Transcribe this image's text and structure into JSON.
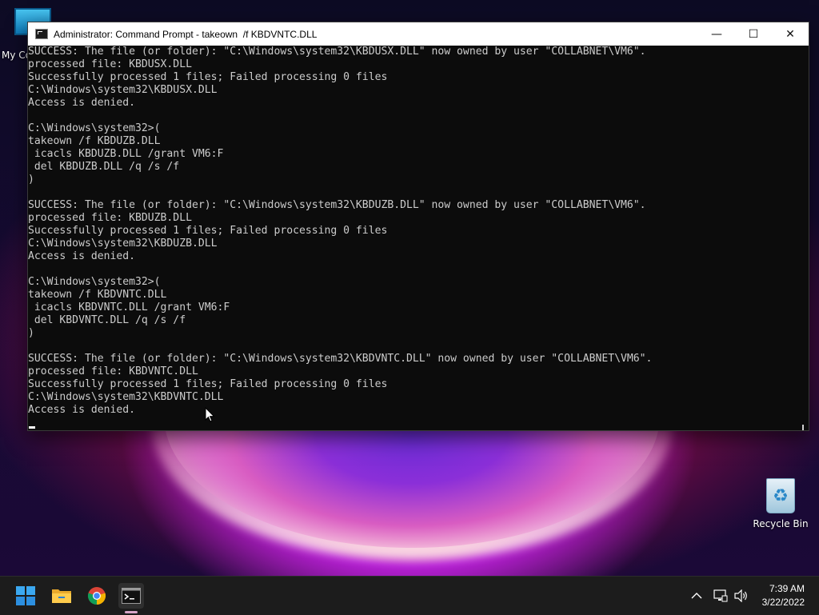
{
  "desktop": {
    "icons": [
      {
        "label": "My Co",
        "name": "my-computer"
      },
      {
        "label": "Recycle Bin",
        "name": "recycle-bin"
      }
    ]
  },
  "window": {
    "title": "Administrator: Command Prompt - takeown  /f KBDVNTC.DLL",
    "buttons": {
      "minimize": "—",
      "maximize": "☐",
      "close": "✕"
    }
  },
  "console": {
    "lines": [
      "SUCCESS: The file (or folder): \"C:\\Windows\\system32\\KBDUSX.DLL\" now owned by user \"COLLABNET\\VM6\".",
      "processed file: KBDUSX.DLL",
      "Successfully processed 1 files; Failed processing 0 files",
      "C:\\Windows\\system32\\KBDUSX.DLL",
      "Access is denied.",
      "",
      "C:\\Windows\\system32>(",
      "takeown /f KBDUZB.DLL",
      " icacls KBDUZB.DLL /grant VM6:F",
      " del KBDUZB.DLL /q /s /f",
      ")",
      "",
      "SUCCESS: The file (or folder): \"C:\\Windows\\system32\\KBDUZB.DLL\" now owned by user \"COLLABNET\\VM6\".",
      "processed file: KBDUZB.DLL",
      "Successfully processed 1 files; Failed processing 0 files",
      "C:\\Windows\\system32\\KBDUZB.DLL",
      "Access is denied.",
      "",
      "C:\\Windows\\system32>(",
      "takeown /f KBDVNTC.DLL",
      " icacls KBDVNTC.DLL /grant VM6:F",
      " del KBDVNTC.DLL /q /s /f",
      ")",
      "",
      "SUCCESS: The file (or folder): \"C:\\Windows\\system32\\KBDVNTC.DLL\" now owned by user \"COLLABNET\\VM6\".",
      "processed file: KBDVNTC.DLL",
      "Successfully processed 1 files; Failed processing 0 files",
      "C:\\Windows\\system32\\KBDVNTC.DLL",
      "Access is denied."
    ]
  },
  "taskbar": {
    "apps": [
      {
        "name": "start-button",
        "icon": "windows-logo-icon"
      },
      {
        "name": "file-explorer-button",
        "icon": "folder-icon"
      },
      {
        "name": "chrome-button",
        "icon": "chrome-icon"
      },
      {
        "name": "command-prompt-button",
        "icon": "terminal-icon",
        "active": true
      }
    ],
    "tray": {
      "chevron": "^",
      "time": "7:39 AM",
      "date": "3/22/2022"
    }
  },
  "colors": {
    "console_bg": "#0c0c0c",
    "console_fg": "#cccccc",
    "taskbar_bg": "#1c1c1c",
    "accent": "#0078d4"
  }
}
